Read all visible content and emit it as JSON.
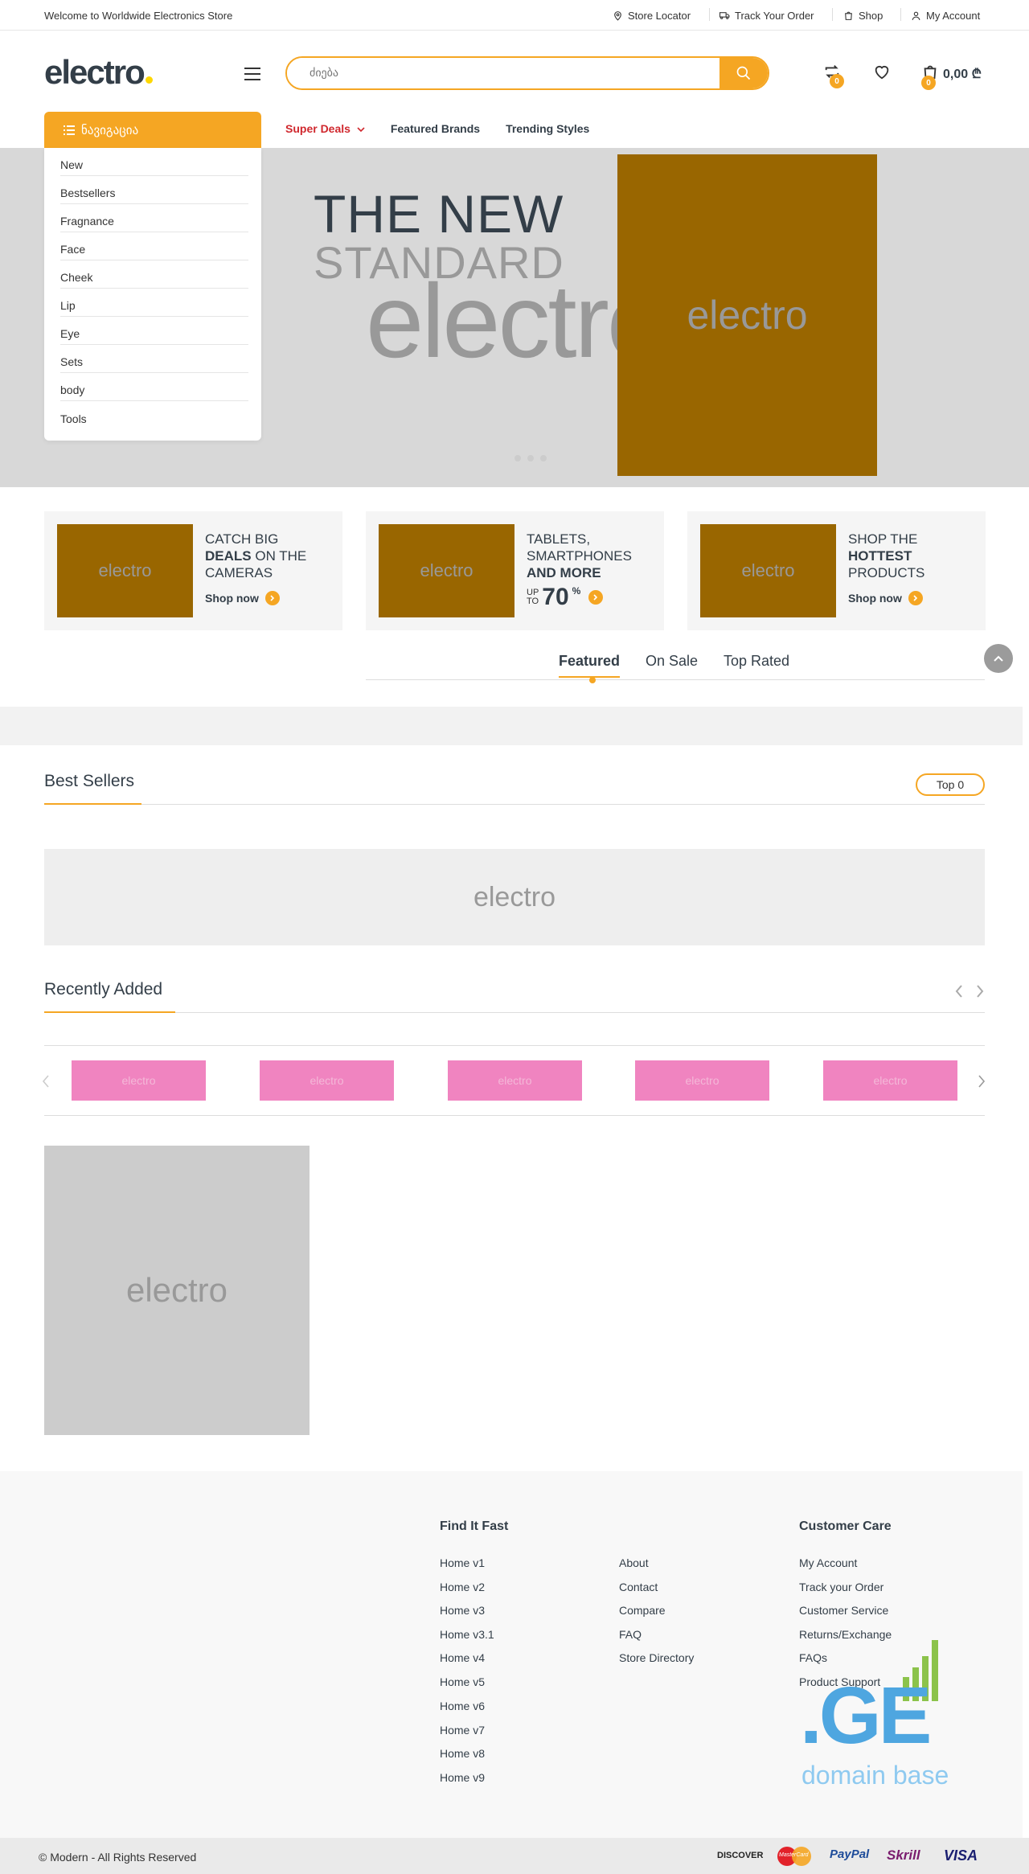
{
  "topbar": {
    "welcome": "Welcome to Worldwide Electronics Store",
    "links": [
      "Store Locator",
      "Track Your Order",
      "Shop",
      "My Account"
    ]
  },
  "header": {
    "logo": "electro",
    "search_placeholder": "ძიება",
    "compare_count": "0",
    "wishlist_label": "",
    "cart_count": "0",
    "cart_total": "0,00 ₾"
  },
  "nav": {
    "toggle_label": "ნავიგაცია",
    "links": [
      "Super Deals",
      "Featured Brands",
      "Trending Styles"
    ]
  },
  "categories": [
    "New",
    "Bestsellers",
    "Fragnance",
    "Face",
    "Cheek",
    "Lip",
    "Eye",
    "Sets",
    "body",
    "Tools"
  ],
  "hero": {
    "line1": "THE NEW",
    "line2": "STANDARD",
    "line3": "electro",
    "image_label": "electro"
  },
  "banners": [
    {
      "img": "electro",
      "pre": "CATCH BIG",
      "bold": "DEALS",
      "post": "ON THE CAMERAS",
      "cta": "Shop now"
    },
    {
      "img": "electro",
      "pre": "TABLETS, SMARTPHONES",
      "bold": "AND MORE",
      "upto_a": "UP",
      "upto_b": "TO",
      "pct": "70",
      "pct_sign": "%"
    },
    {
      "img": "electro",
      "pre": "SHOP THE",
      "bold": "HOTTEST",
      "post": "PRODUCTS",
      "cta": "Shop now"
    }
  ],
  "tabs": [
    "Featured",
    "On Sale",
    "Top Rated"
  ],
  "best_sellers": {
    "title": "Best Sellers",
    "badge": "Top 0",
    "banner": "electro"
  },
  "recently_added": {
    "title": "Recently Added",
    "items": [
      "electro",
      "electro",
      "electro",
      "electro",
      "electro"
    ]
  },
  "big_image": "electro",
  "footer": {
    "find_title": "Find It Fast",
    "find_col1": [
      "Home v1",
      "Home v2",
      "Home v3",
      "Home v3.1",
      "Home v4",
      "Home v5",
      "Home v6",
      "Home v7",
      "Home v8",
      "Home v9"
    ],
    "find_col2": [
      "About",
      "Contact",
      "Compare",
      "FAQ",
      "Store Directory"
    ],
    "care_title": "Customer Care",
    "care_links": [
      "My Account",
      "Track your Order",
      "Customer Service",
      "Returns/Exchange",
      "FAQs",
      "Product Support"
    ],
    "domain_logo": ".GE",
    "domain_text": "domain base"
  },
  "bottom": {
    "copyright": "© Modern - All Rights Reserved",
    "payments": [
      "DISCOVER",
      "MasterCard",
      "PayPal",
      "Skrill",
      "VISA"
    ]
  },
  "colors": {
    "accent": "#f5a623",
    "hot": "#d0282e",
    "placeholder_img": "#996600",
    "pink": "#f084c0"
  }
}
